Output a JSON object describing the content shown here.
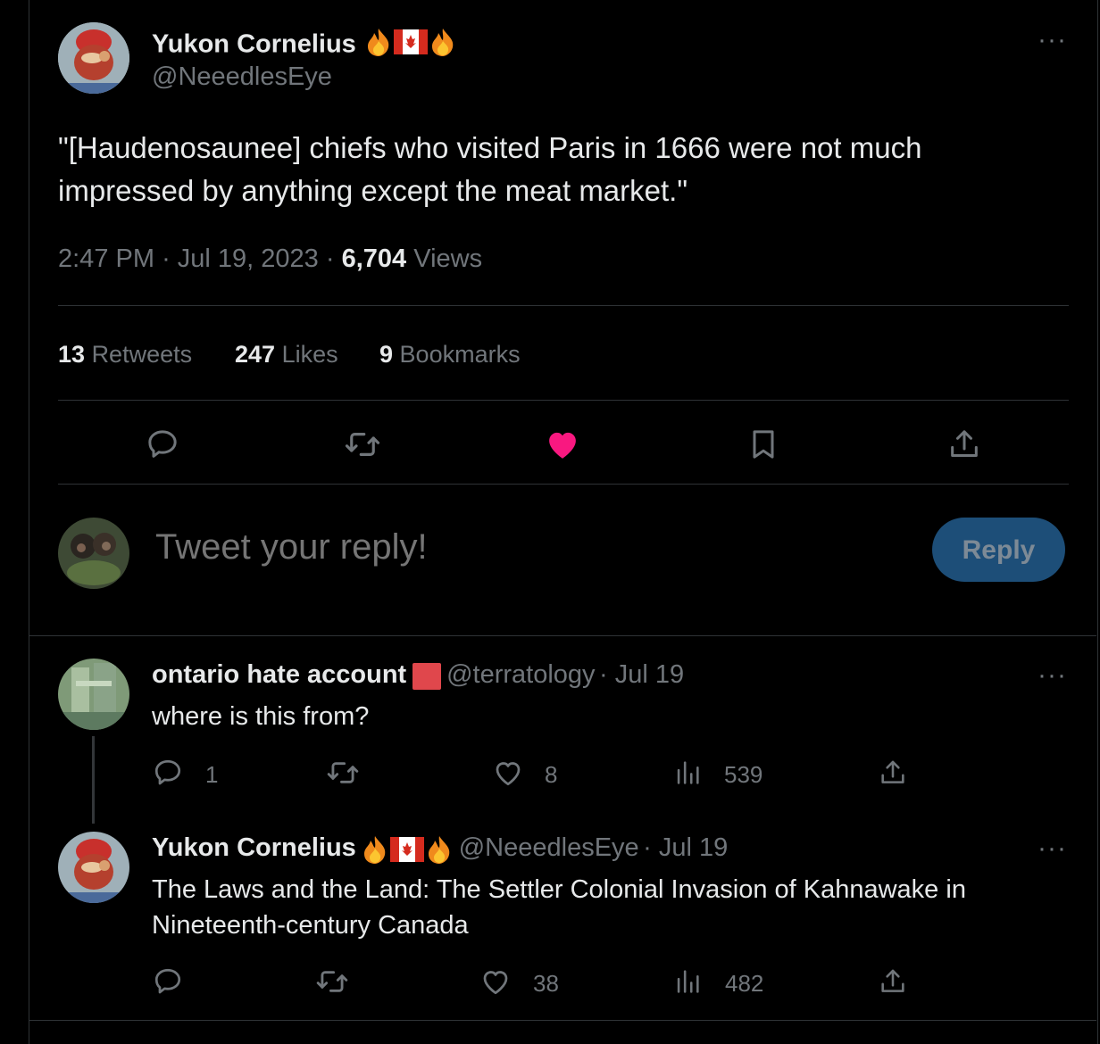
{
  "main_tweet": {
    "author_name": "Yukon Cornelius",
    "author_handle": "@NeeedlesEye",
    "text": "\"[Haudenosaunee] chiefs who visited Paris in 1666 were not much impressed by anything except the meat market.\"",
    "time": "2:47 PM",
    "date": "Jul 19, 2023",
    "separator": "·",
    "views_count": "6,704",
    "views_label": "Views",
    "retweets_count": "13",
    "retweets_label": "Retweets",
    "likes_count": "247",
    "likes_label": "Likes",
    "bookmarks_count": "9",
    "bookmarks_label": "Bookmarks",
    "liked": true
  },
  "reply_box": {
    "placeholder": "Tweet your reply!",
    "button_label": "Reply"
  },
  "replies": [
    {
      "author_name": "ontario hate account",
      "author_handle": "@terratology",
      "date": "· Jul 19",
      "text": "where is this from?",
      "reply_count": "1",
      "retweet_count": "",
      "like_count": "8",
      "view_count": "539"
    },
    {
      "author_name": "Yukon Cornelius",
      "author_handle": "@NeeedlesEye",
      "date": "· Jul 19",
      "text": "The Laws and the Land: The Settler Colonial Invasion of Kahnawake in Nineteenth-century Canada",
      "reply_count": "",
      "retweet_count": "",
      "like_count": "38",
      "view_count": "482"
    }
  ],
  "colors": {
    "background": "#000000",
    "like_active": "#f91880",
    "muted": "#71767b",
    "reply_button": "#1d4e78",
    "red_square": "#e0474c"
  },
  "icons": [
    "fire-icon",
    "canada-flag-icon",
    "more-icon",
    "reply-icon",
    "retweet-icon",
    "heart-icon",
    "bookmark-icon",
    "share-icon",
    "views-icon"
  ]
}
